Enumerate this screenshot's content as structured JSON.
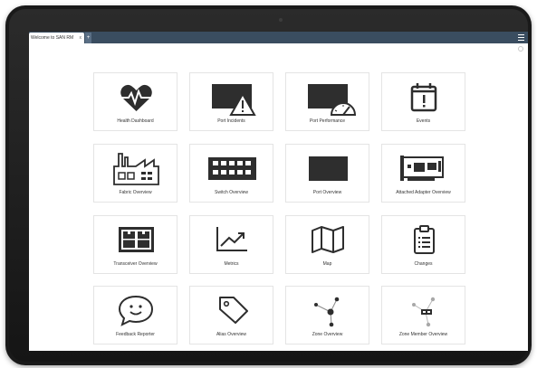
{
  "window": {
    "tab_title": "Welcome to SAN RM",
    "tab_close": "x",
    "add_tab": "+"
  },
  "tiles": [
    {
      "label": "Health Dashboard",
      "icon": "heart-pulse-icon"
    },
    {
      "label": "Port Incidents",
      "icon": "port-warning-icon"
    },
    {
      "label": "Port Performance",
      "icon": "port-gauge-icon"
    },
    {
      "label": "Events",
      "icon": "calendar-alert-icon"
    },
    {
      "label": "Fabric Overview",
      "icon": "factory-icon"
    },
    {
      "label": "Switch Overview",
      "icon": "switch-icon"
    },
    {
      "label": "Port Overview",
      "icon": "port-icon"
    },
    {
      "label": "Attached Adapter Overview",
      "icon": "adapter-card-icon"
    },
    {
      "label": "Transceiver Overview",
      "icon": "transceiver-icon"
    },
    {
      "label": "Metrics",
      "icon": "trend-chart-icon"
    },
    {
      "label": "Map",
      "icon": "map-icon"
    },
    {
      "label": "Changes",
      "icon": "clipboard-list-icon"
    },
    {
      "label": "Feedback Reporter",
      "icon": "smiley-bubble-icon"
    },
    {
      "label": "Alias Overview",
      "icon": "tag-icon"
    },
    {
      "label": "Zone Overview",
      "icon": "zone-network-icon"
    },
    {
      "label": "Zone Member Overview",
      "icon": "zone-member-icon"
    }
  ],
  "colors": {
    "tab_bar": "#3a4d60",
    "icon": "#2e2e2e",
    "icon_muted": "#a8a8a8",
    "tile_border": "#e4e4e4"
  }
}
